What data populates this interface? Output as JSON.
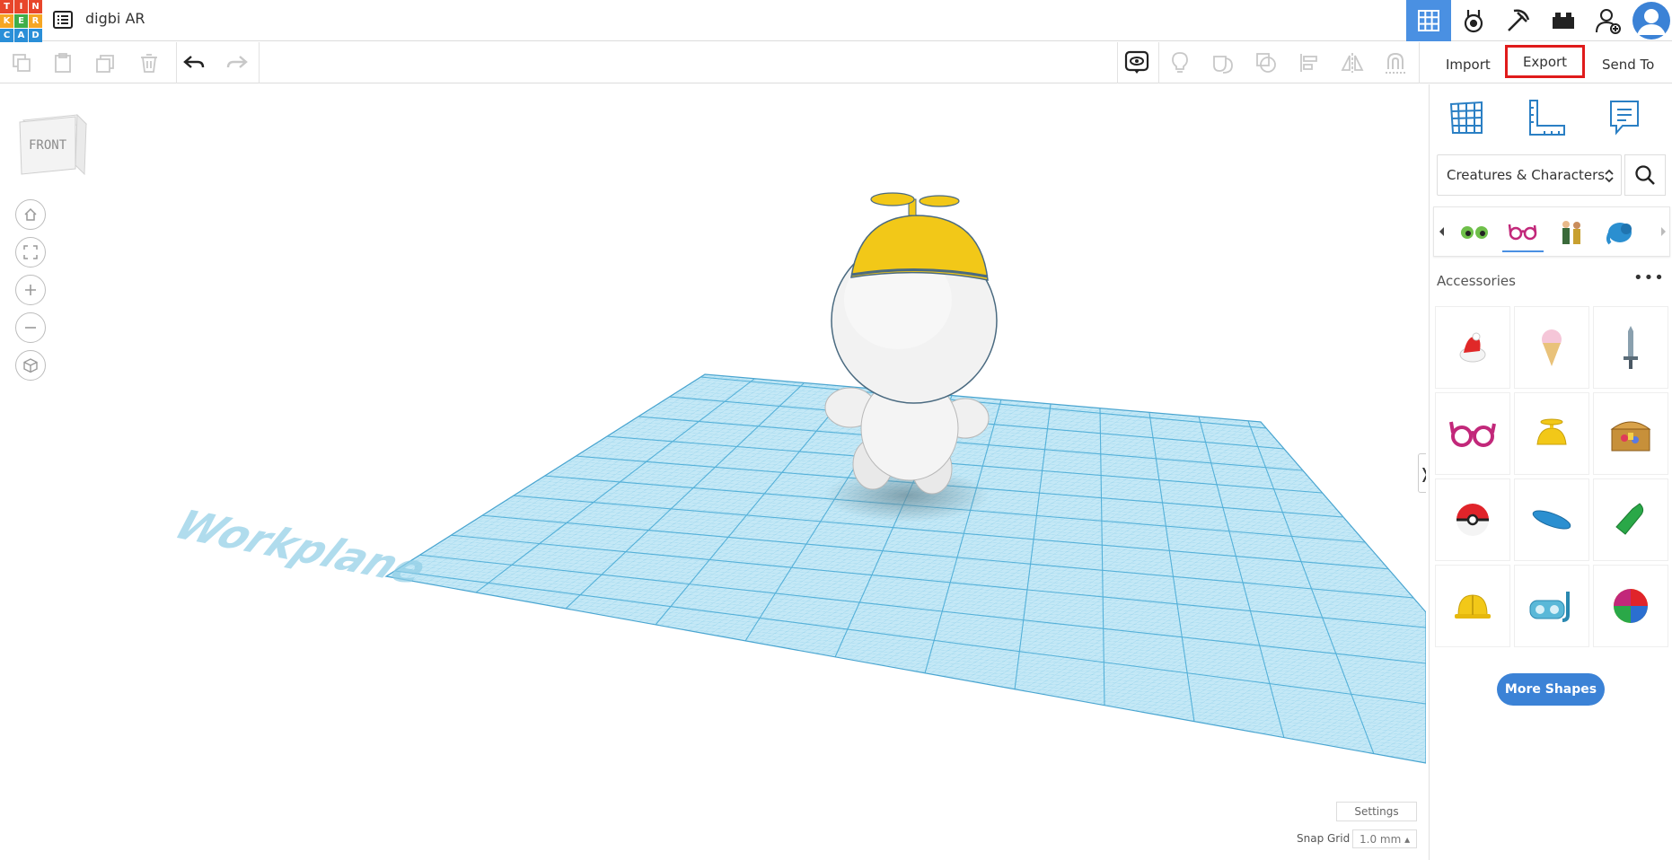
{
  "app": {
    "logo_letters": [
      "T",
      "I",
      "N",
      "K",
      "E",
      "R",
      "C",
      "A",
      "D"
    ],
    "document_title": "digbi AR"
  },
  "topbar": {
    "icons": [
      "3d-design-icon",
      "circuits-icon",
      "minecraft-pickaxe-icon",
      "lego-brick-icon",
      "add-user-icon",
      "avatar"
    ]
  },
  "toolbar": {
    "import_label": "Import",
    "export_label": "Export",
    "sendto_label": "Send To"
  },
  "viewport": {
    "viewcube_label": "FRONT",
    "workplane_label": "Workplane",
    "settings_label": "Settings",
    "snap_grid_label": "Snap Grid",
    "snap_grid_value": "1.0 mm ▴",
    "collapse_label": "❭"
  },
  "panel": {
    "category": "Creatures & Characters",
    "section_title": "Accessories",
    "more_dots": "•••",
    "more_shapes_label": "More Shapes",
    "shapes": [
      "santa-hat",
      "ice-cream-cone",
      "sword",
      "glasses",
      "propeller-hat",
      "treasure-chest",
      "pokeball",
      "surfboard",
      "flipper",
      "hard-hat",
      "snorkel-mask",
      "beach-ball"
    ]
  },
  "colors": {
    "accent": "#4a90e2",
    "export_highlight": "#e01b1b",
    "workplane": "#b8e2f2",
    "grid_line": "#5fb8dc",
    "hat_yellow": "#f2c818"
  }
}
